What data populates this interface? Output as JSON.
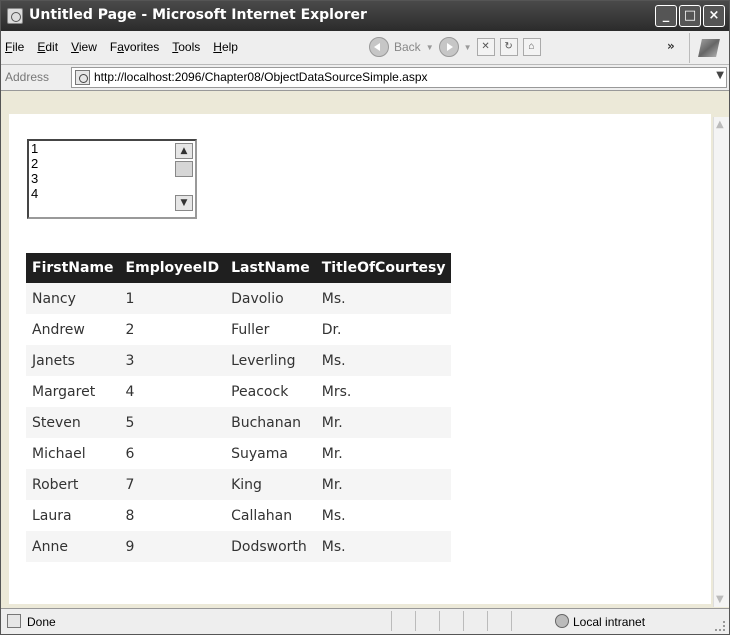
{
  "window": {
    "title": "Untitled Page - Microsoft Internet Explorer",
    "controls": [
      "_",
      "□",
      "×"
    ]
  },
  "menu": {
    "items": [
      {
        "label": "File",
        "accel": "F",
        "rest": "ile"
      },
      {
        "label": "Edit",
        "accel": "E",
        "rest": "dit"
      },
      {
        "label": "View",
        "accel": "V",
        "rest": "iew"
      },
      {
        "label": "Favorites",
        "accel": "a",
        "pre": "F",
        "rest": "vorites"
      },
      {
        "label": "Tools",
        "accel": "T",
        "rest": "ools"
      },
      {
        "label": "Help",
        "accel": "H",
        "rest": "elp"
      }
    ],
    "back_label": "Back",
    "more": "»"
  },
  "address": {
    "label": "Address",
    "url": "http://localhost:2096/Chapter08/ObjectDataSourceSimple.aspx"
  },
  "listbox": {
    "items": [
      "1",
      "2",
      "3",
      "4"
    ]
  },
  "grid": {
    "headers": [
      "FirstName",
      "EmployeeID",
      "LastName",
      "TitleOfCourtesy"
    ],
    "rows": [
      [
        "Nancy",
        "1",
        "Davolio",
        "Ms."
      ],
      [
        "Andrew",
        "2",
        "Fuller",
        "Dr."
      ],
      [
        "Janets",
        "3",
        "Leverling",
        "Ms."
      ],
      [
        "Margaret",
        "4",
        "Peacock",
        "Mrs."
      ],
      [
        "Steven",
        "5",
        "Buchanan",
        "Mr."
      ],
      [
        "Michael",
        "6",
        "Suyama",
        "Mr."
      ],
      [
        "Robert",
        "7",
        "King",
        "Mr."
      ],
      [
        "Laura",
        "8",
        "Callahan",
        "Ms."
      ],
      [
        "Anne",
        "9",
        "Dodsworth",
        "Ms."
      ]
    ]
  },
  "status": {
    "text": "Done",
    "zone": "Local intranet"
  }
}
